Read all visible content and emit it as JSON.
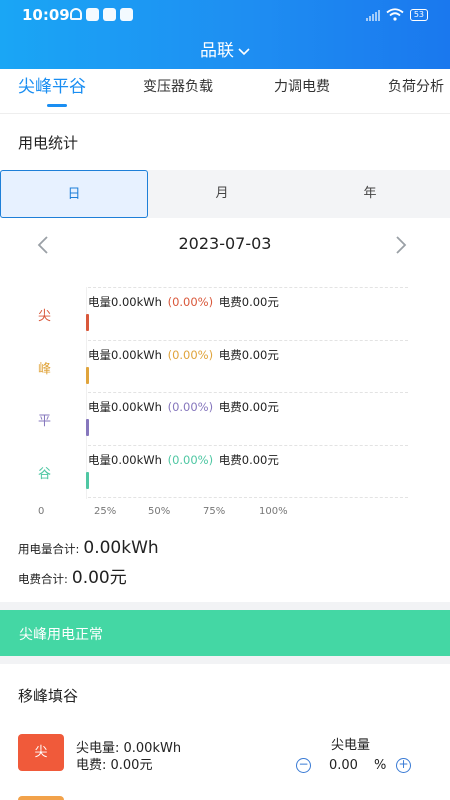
{
  "status_bar": {
    "time": "10:09",
    "battery": "53"
  },
  "header": {
    "title": "品联"
  },
  "tabs": [
    {
      "label": "尖峰平谷",
      "active": true
    },
    {
      "label": "变压器负载",
      "active": false
    },
    {
      "label": "力调电费",
      "active": false
    },
    {
      "label": "负荷分析",
      "active": false
    }
  ],
  "stats": {
    "section_title": "用电统计",
    "periods": [
      "日",
      "月",
      "年"
    ],
    "selected_period": "日",
    "date": "2023-07-03",
    "rows": [
      {
        "label": "尖",
        "energy_text": "电量0.00kWh",
        "pct": "(0.00%)",
        "fee_text": "电费0.00元",
        "color": "#d9583b",
        "share": 0
      },
      {
        "label": "峰",
        "energy_text": "电量0.00kWh",
        "pct": "(0.00%)",
        "fee_text": "电费0.00元",
        "color": "#e0a43c",
        "share": 0
      },
      {
        "label": "平",
        "energy_text": "电量0.00kWh",
        "pct": "(0.00%)",
        "fee_text": "电费0.00元",
        "color": "#8677bd",
        "share": 0
      },
      {
        "label": "谷",
        "energy_text": "电量0.00kWh",
        "pct": "(0.00%)",
        "fee_text": "电费0.00元",
        "color": "#4fc7a3",
        "share": 0
      }
    ],
    "axis_ticks": [
      "0",
      "25%",
      "50%",
      "75%",
      "100%"
    ],
    "total_energy_label": "用电量合计:",
    "total_energy": "0.00kWh",
    "total_fee_label": "电费合计:",
    "total_fee": "0.00元"
  },
  "banner": {
    "text": "尖峰用电正常"
  },
  "shift": {
    "section_title": "移峰填谷",
    "items": [
      {
        "icon_label": "尖",
        "icon_color": "#f05a3a",
        "energy_line": "尖电量: 0.00kWh",
        "fee_line": "电费: 0.00元",
        "control_label": "尖电量",
        "value": "0.00",
        "unit": "%",
        "minus": "−",
        "plus": "+"
      }
    ]
  }
}
